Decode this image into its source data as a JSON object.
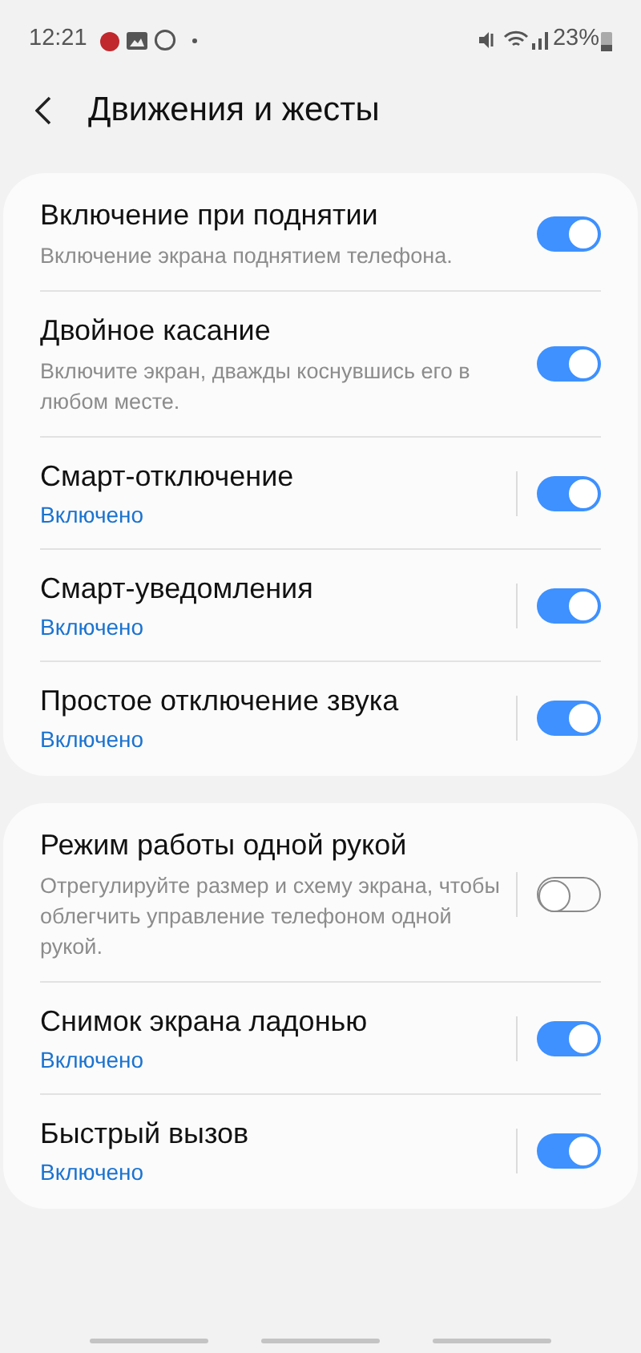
{
  "status_bar": {
    "time": "12:21",
    "battery": "23%"
  },
  "header": {
    "title": "Движения и жесты"
  },
  "groups": [
    {
      "items": [
        {
          "title": "Включение при поднятии",
          "subtitle": "Включение экрана поднятием телефона.",
          "kind": "description",
          "divider": false,
          "on": true
        },
        {
          "title": "Двойное касание",
          "subtitle": "Включите экран, дважды коснувшись его в любом месте.",
          "kind": "description",
          "divider": false,
          "on": true
        },
        {
          "title": "Смарт-отключение",
          "subtitle": "Включено",
          "kind": "status",
          "divider": true,
          "on": true
        },
        {
          "title": "Смарт-уведомления",
          "subtitle": "Включено",
          "kind": "status",
          "divider": true,
          "on": true
        },
        {
          "title": "Простое отключение звука",
          "subtitle": "Включено",
          "kind": "status",
          "divider": true,
          "on": true
        }
      ]
    },
    {
      "items": [
        {
          "title": "Режим работы одной рукой",
          "subtitle": "Отрегулируйте размер и схему экрана, чтобы облегчить управление телефоном одной рукой.",
          "kind": "description",
          "divider": true,
          "on": false
        },
        {
          "title": "Снимок экрана ладонью",
          "subtitle": "Включено",
          "kind": "status",
          "divider": true,
          "on": true
        },
        {
          "title": "Быстрый вызов",
          "subtitle": "Включено",
          "kind": "status",
          "divider": true,
          "on": true
        }
      ]
    }
  ]
}
